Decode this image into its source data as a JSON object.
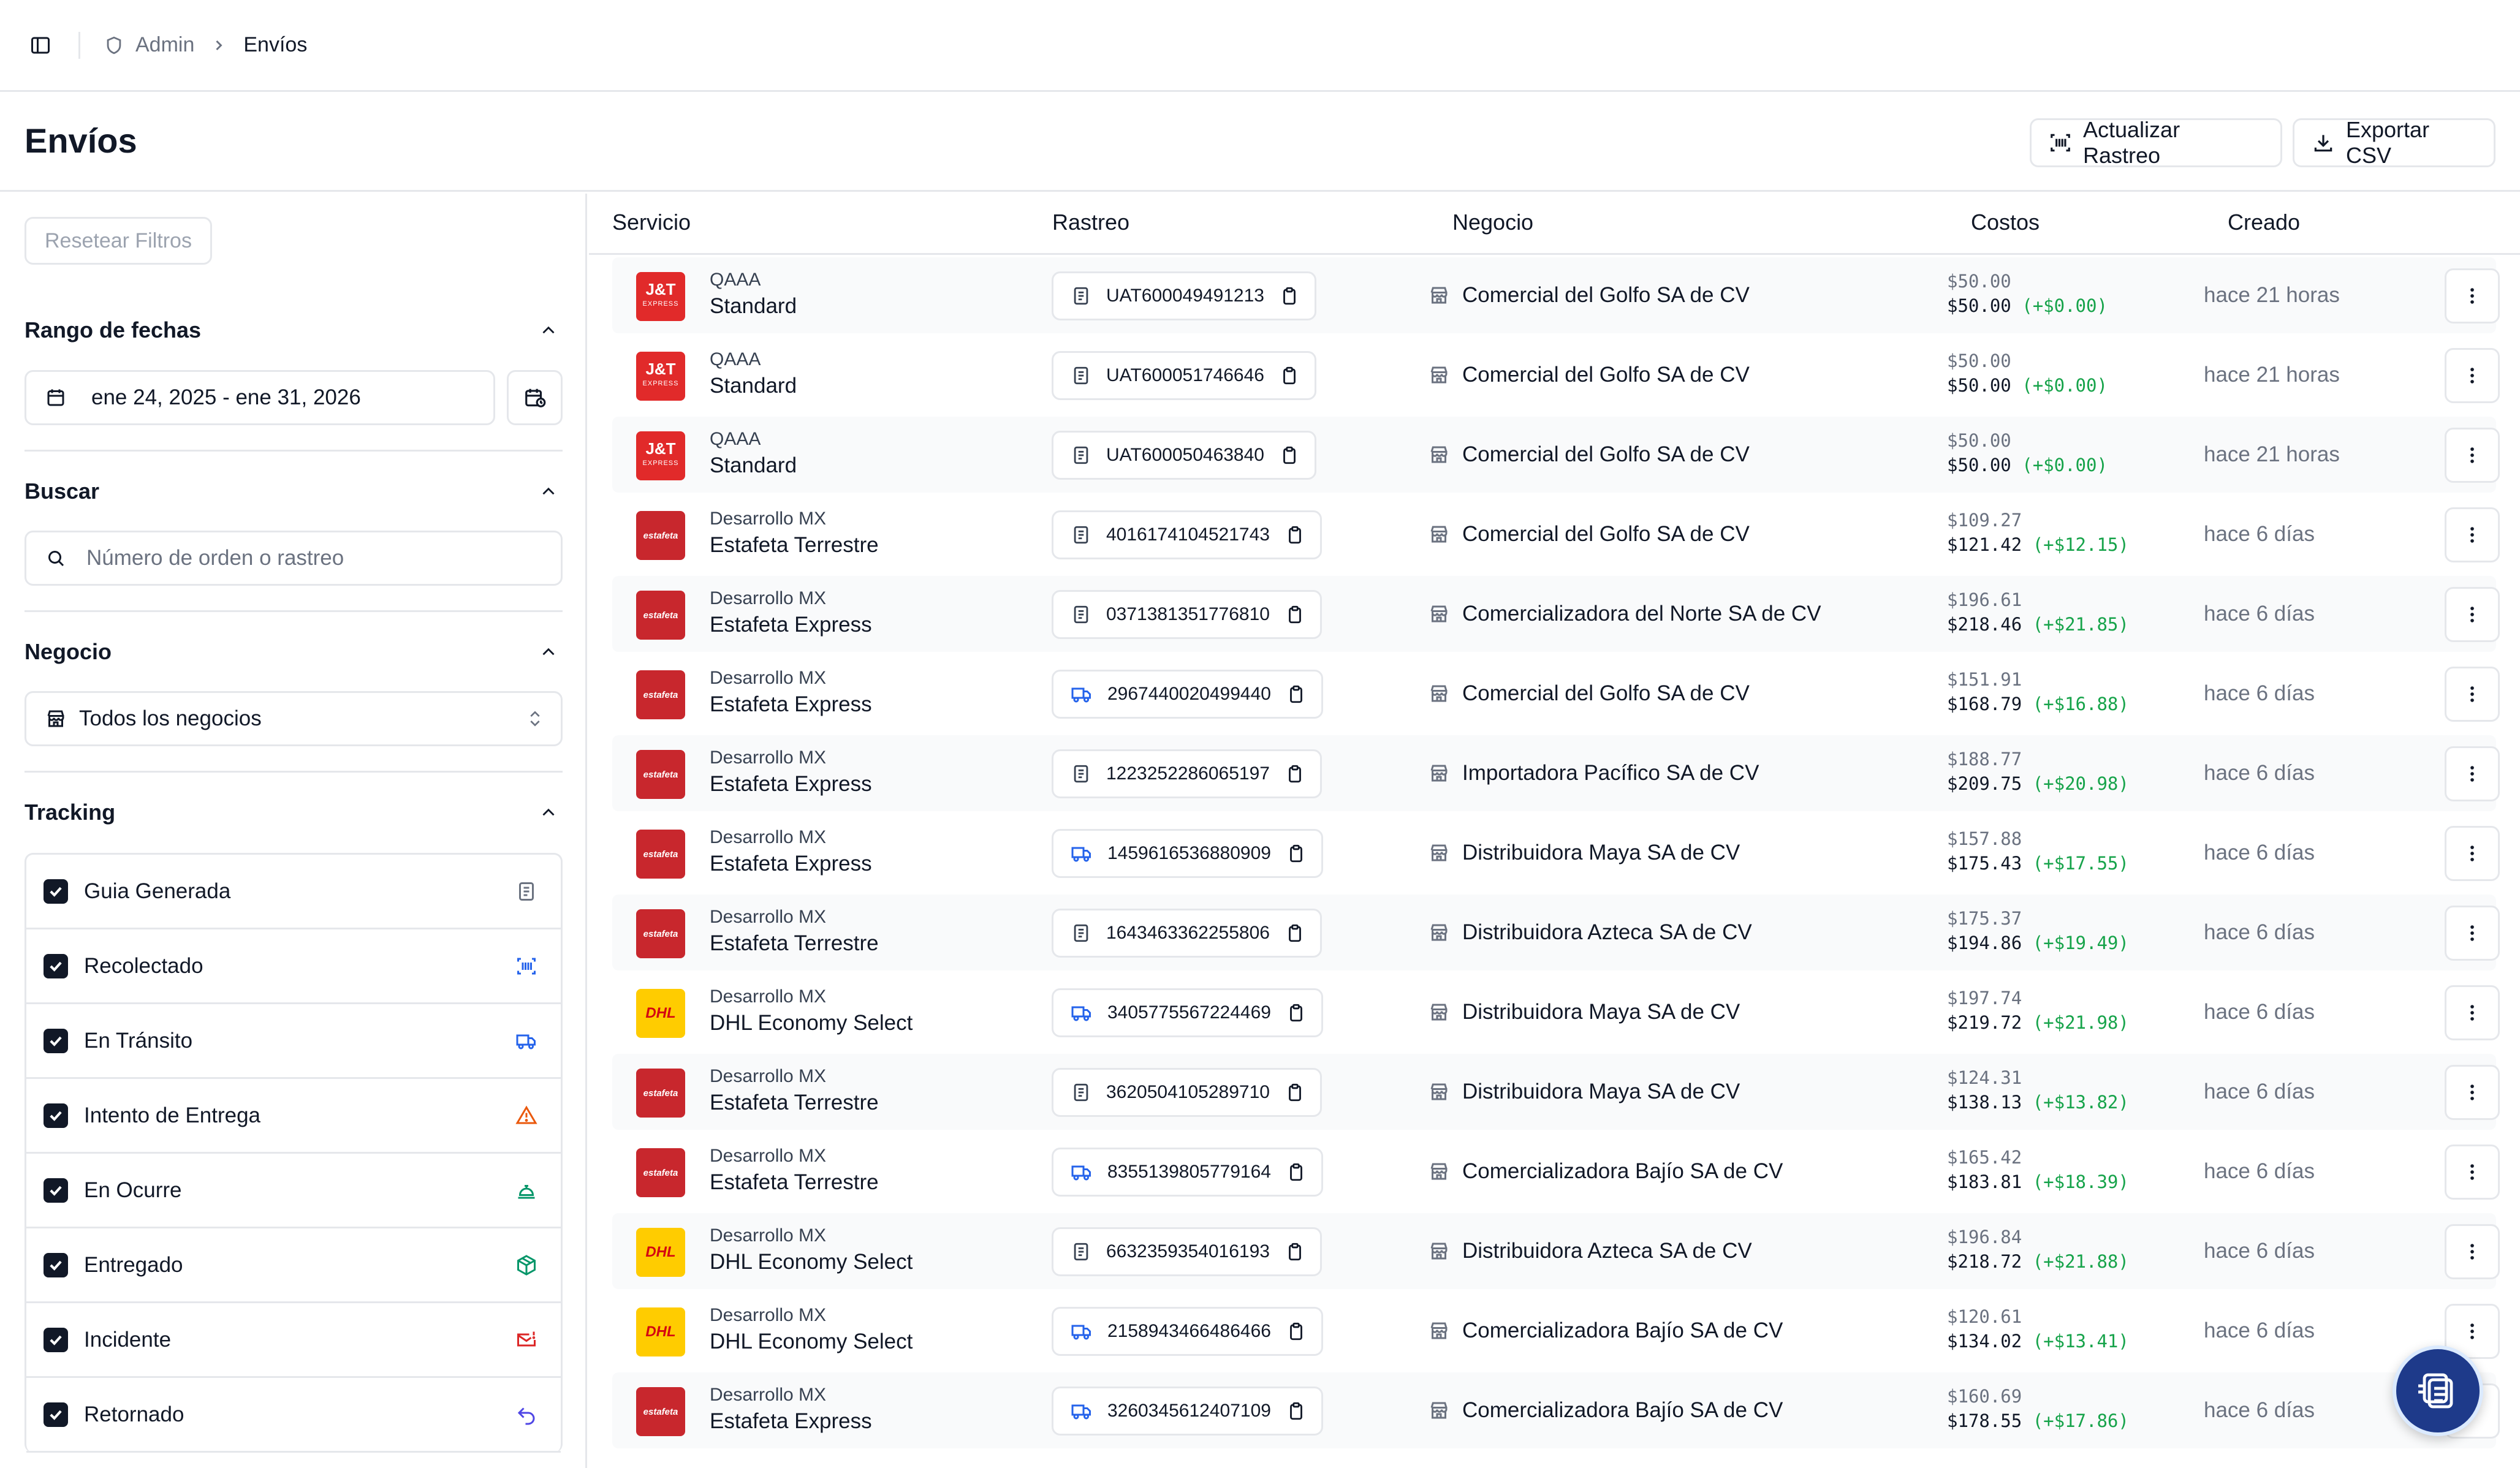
{
  "breadcrumb": {
    "admin": "Admin",
    "current": "Envíos"
  },
  "header": {
    "title": "Envíos",
    "refresh_label": "Actualizar Rastreo",
    "export_label": "Exportar CSV"
  },
  "sidebar": {
    "reset_label": "Resetear Filtros",
    "date_section": "Rango de fechas",
    "date_value": "ene 24, 2025 - ene 31, 2026",
    "search_section": "Buscar",
    "search_placeholder": "Número de orden o rastreo",
    "business_section": "Negocio",
    "business_value": "Todos los negocios",
    "tracking_section": "Tracking",
    "tracking_items": [
      {
        "label": "Guia Generada",
        "checked": true,
        "icon": "document-icon",
        "color": "#6b7280"
      },
      {
        "label": "Recolectado",
        "checked": true,
        "icon": "scan-icon",
        "color": "#2563eb"
      },
      {
        "label": "En Tránsito",
        "checked": true,
        "icon": "truck-icon",
        "color": "#2563eb"
      },
      {
        "label": "Intento de Entrega",
        "checked": true,
        "icon": "warning-icon",
        "color": "#ea580c"
      },
      {
        "label": "En Ocurre",
        "checked": true,
        "icon": "bell-icon",
        "color": "#059669"
      },
      {
        "label": "Entregado",
        "checked": true,
        "icon": "package-icon",
        "color": "#059669"
      },
      {
        "label": "Incidente",
        "checked": true,
        "icon": "mail-alert-icon",
        "color": "#dc2626"
      },
      {
        "label": "Retornado",
        "checked": true,
        "icon": "return-icon",
        "color": "#4f46e5"
      }
    ]
  },
  "table": {
    "columns": [
      "Servicio",
      "Rastreo",
      "Negocio",
      "Costos",
      "Creado"
    ],
    "rows": [
      {
        "logo": "jt",
        "carrier": "QAAA",
        "service": "Standard",
        "tracking": "UAT600049491213",
        "status_icon": "doc",
        "business": "Comercial del Golfo SA de CV",
        "cost_base": "$50.00",
        "cost_total": "$50.00",
        "cost_diff": "(+$0.00)",
        "created": "hace 21 horas"
      },
      {
        "logo": "jt",
        "carrier": "QAAA",
        "service": "Standard",
        "tracking": "UAT600051746646",
        "status_icon": "doc",
        "business": "Comercial del Golfo SA de CV",
        "cost_base": "$50.00",
        "cost_total": "$50.00",
        "cost_diff": "(+$0.00)",
        "created": "hace 21 horas"
      },
      {
        "logo": "jt",
        "carrier": "QAAA",
        "service": "Standard",
        "tracking": "UAT600050463840",
        "status_icon": "doc",
        "business": "Comercial del Golfo SA de CV",
        "cost_base": "$50.00",
        "cost_total": "$50.00",
        "cost_diff": "(+$0.00)",
        "created": "hace 21 horas"
      },
      {
        "logo": "estafeta",
        "carrier": "Desarrollo MX",
        "service": "Estafeta Terrestre",
        "tracking": "4016174104521743",
        "status_icon": "doc",
        "business": "Comercial del Golfo SA de CV",
        "cost_base": "$109.27",
        "cost_total": "$121.42",
        "cost_diff": "(+$12.15)",
        "created": "hace 6 días"
      },
      {
        "logo": "estafeta",
        "carrier": "Desarrollo MX",
        "service": "Estafeta Express",
        "tracking": "0371381351776810",
        "status_icon": "doc",
        "business": "Comercializadora del Norte SA de CV",
        "cost_base": "$196.61",
        "cost_total": "$218.46",
        "cost_diff": "(+$21.85)",
        "created": "hace 6 días"
      },
      {
        "logo": "estafeta",
        "carrier": "Desarrollo MX",
        "service": "Estafeta Express",
        "tracking": "2967440020499440",
        "status_icon": "truck",
        "business": "Comercial del Golfo SA de CV",
        "cost_base": "$151.91",
        "cost_total": "$168.79",
        "cost_diff": "(+$16.88)",
        "created": "hace 6 días"
      },
      {
        "logo": "estafeta",
        "carrier": "Desarrollo MX",
        "service": "Estafeta Express",
        "tracking": "1223252286065197",
        "status_icon": "doc",
        "business": "Importadora Pacífico SA de CV",
        "cost_base": "$188.77",
        "cost_total": "$209.75",
        "cost_diff": "(+$20.98)",
        "created": "hace 6 días"
      },
      {
        "logo": "estafeta",
        "carrier": "Desarrollo MX",
        "service": "Estafeta Express",
        "tracking": "1459616536880909",
        "status_icon": "truck",
        "business": "Distribuidora Maya SA de CV",
        "cost_base": "$157.88",
        "cost_total": "$175.43",
        "cost_diff": "(+$17.55)",
        "created": "hace 6 días"
      },
      {
        "logo": "estafeta",
        "carrier": "Desarrollo MX",
        "service": "Estafeta Terrestre",
        "tracking": "1643463362255806",
        "status_icon": "doc",
        "business": "Distribuidora Azteca SA de CV",
        "cost_base": "$175.37",
        "cost_total": "$194.86",
        "cost_diff": "(+$19.49)",
        "created": "hace 6 días"
      },
      {
        "logo": "dhl",
        "carrier": "Desarrollo MX",
        "service": "DHL Economy Select",
        "tracking": "3405775567224469",
        "status_icon": "truck",
        "business": "Distribuidora Maya SA de CV",
        "cost_base": "$197.74",
        "cost_total": "$219.72",
        "cost_diff": "(+$21.98)",
        "created": "hace 6 días"
      },
      {
        "logo": "estafeta",
        "carrier": "Desarrollo MX",
        "service": "Estafeta Terrestre",
        "tracking": "3620504105289710",
        "status_icon": "doc",
        "business": "Distribuidora Maya SA de CV",
        "cost_base": "$124.31",
        "cost_total": "$138.13",
        "cost_diff": "(+$13.82)",
        "created": "hace 6 días"
      },
      {
        "logo": "estafeta",
        "carrier": "Desarrollo MX",
        "service": "Estafeta Terrestre",
        "tracking": "8355139805779164",
        "status_icon": "truck",
        "business": "Comercializadora Bajío SA de CV",
        "cost_base": "$165.42",
        "cost_total": "$183.81",
        "cost_diff": "(+$18.39)",
        "created": "hace 6 días"
      },
      {
        "logo": "dhl",
        "carrier": "Desarrollo MX",
        "service": "DHL Economy Select",
        "tracking": "6632359354016193",
        "status_icon": "doc",
        "business": "Distribuidora Azteca SA de CV",
        "cost_base": "$196.84",
        "cost_total": "$218.72",
        "cost_diff": "(+$21.88)",
        "created": "hace 6 días"
      },
      {
        "logo": "dhl",
        "carrier": "Desarrollo MX",
        "service": "DHL Economy Select",
        "tracking": "2158943466486466",
        "status_icon": "truck",
        "business": "Comercializadora Bajío SA de CV",
        "cost_base": "$120.61",
        "cost_total": "$134.02",
        "cost_diff": "(+$13.41)",
        "created": "hace 6 días"
      },
      {
        "logo": "estafeta",
        "carrier": "Desarrollo MX",
        "service": "Estafeta Express",
        "tracking": "3260345612407109",
        "status_icon": "truck",
        "business": "Comercializadora Bajío SA de CV",
        "cost_base": "$160.69",
        "cost_total": "$178.55",
        "cost_diff": "(+$17.86)",
        "created": "hace 6 días"
      }
    ]
  },
  "colors": {
    "border": "#e5e7eb",
    "text": "#111827",
    "muted": "#6b7280",
    "positive": "#16a34a",
    "fab": "#1e3a8a"
  }
}
